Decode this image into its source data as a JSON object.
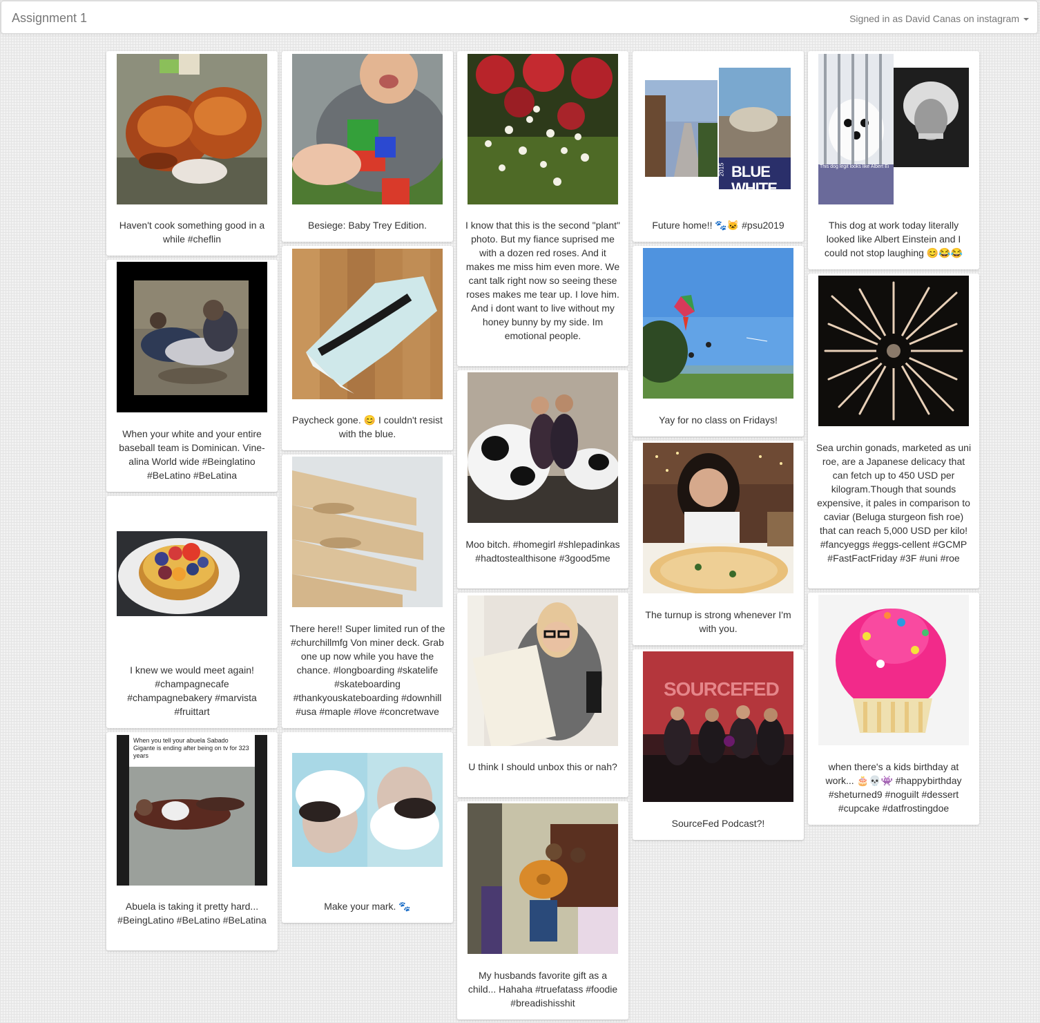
{
  "navbar": {
    "brand": "Assignment 1",
    "signin": "Signed in as David Canas on instagram"
  },
  "posts": [
    {
      "caption": "Haven't cook something good in a while #cheflin",
      "image": "glazed-meatballs-photo"
    },
    {
      "caption": "When your white and your entire baseball team is Dominican. Vine-alina World wide #Beinglatino #BeLatino #BeLatina",
      "image": "blurry-teammates-photo"
    },
    {
      "caption": "I knew we would meet again! #champagnecafe #champagnebakery #marvista #fruittart",
      "image": "fruit-tart-photo"
    },
    {
      "caption": "Abuela is taking it pretty hard... #BeingLatino #BeLatino #BeLatina",
      "image": "abuela-meme-photo",
      "overlay_text": "When you tell your abuela Sabado Gigante is ending after being on tv for 323 years"
    },
    {
      "caption": "Besiege: Baby Trey Edition.",
      "image": "baby-with-blocks-photo"
    },
    {
      "caption": "Paycheck gone. 😊 I couldn't resist with the blue.",
      "image": "sneaker-photo"
    },
    {
      "caption": "There here!! Super limited run of the #churchillmfg Von miner deck. Grab one up now while you have the chance. #longboarding #skatelife #skateboarding #thankyouskateboarding #downhill #usa #maple #love #concretwave",
      "image": "skateboard-decks-photo"
    },
    {
      "caption": "Make your mark. 🐾",
      "image": "mirrored-selfie-photo"
    },
    {
      "caption": "I know that this is the second \"plant\" photo. But my fiance suprised me with a dozen red roses. And it makes me miss him even more. We cant talk right now so seeing these roses makes me tear up. I love him. And i dont want to live without my honey bunny by my side. Im emotional people.",
      "image": "roses-bouquet-photo"
    },
    {
      "caption": "Moo bitch. #homegirl #shlepadinkas #hadtostealthisone #3good5me",
      "image": "cow-statue-friends-photo"
    },
    {
      "caption": "U think I should unbox this or nah?",
      "image": "unbox-selfie-photo"
    },
    {
      "caption": "My husbands favorite gift as a child... Hahaha #truefatass #foodie #breadishisshit",
      "image": "kids-donut-photo"
    },
    {
      "caption": "Future home!! 🐾🐱 #psu2019",
      "image": "campus-collage-photo",
      "overlay_text": "BLUE WHITE",
      "overlay_year": "2015"
    },
    {
      "caption": "Yay for no class on Fridays!",
      "image": "kite-beach-photo"
    },
    {
      "caption": "The turnup is strong whenever I'm with you.",
      "image": "pizza-dinner-photo"
    },
    {
      "caption": "SourceFed Podcast?!",
      "image": "sourcefed-studio-photo",
      "overlay_text": "SOURCEFED"
    },
    {
      "caption": "This dog at work today literally looked like Albert Einstein and I could not stop laughing 😊😂😂",
      "image": "dog-einstein-photo",
      "overlay_text": "This dog legit looks like Albert Einstein"
    },
    {
      "caption": "Sea urchin gonads, marketed as uni roe, are a Japanese delicacy that can fetch up to 450 USD per kilogram.Though that sounds expensive, it pales in comparison to caviar (Beluga sturgeon fish roe) that can reach 5,000 USD per kilo! #fancyeggs #eggs-cellent #GCMP #FastFactFriday #3F #uni #roe",
      "image": "sea-urchin-photo"
    },
    {
      "caption": "when there's a kids birthday at work... 🎂💀👾 #happybirthday #sheturned9 #noguilt #dessert #cupcake #datfrostingdoe",
      "image": "pink-cupcake-photo"
    }
  ]
}
